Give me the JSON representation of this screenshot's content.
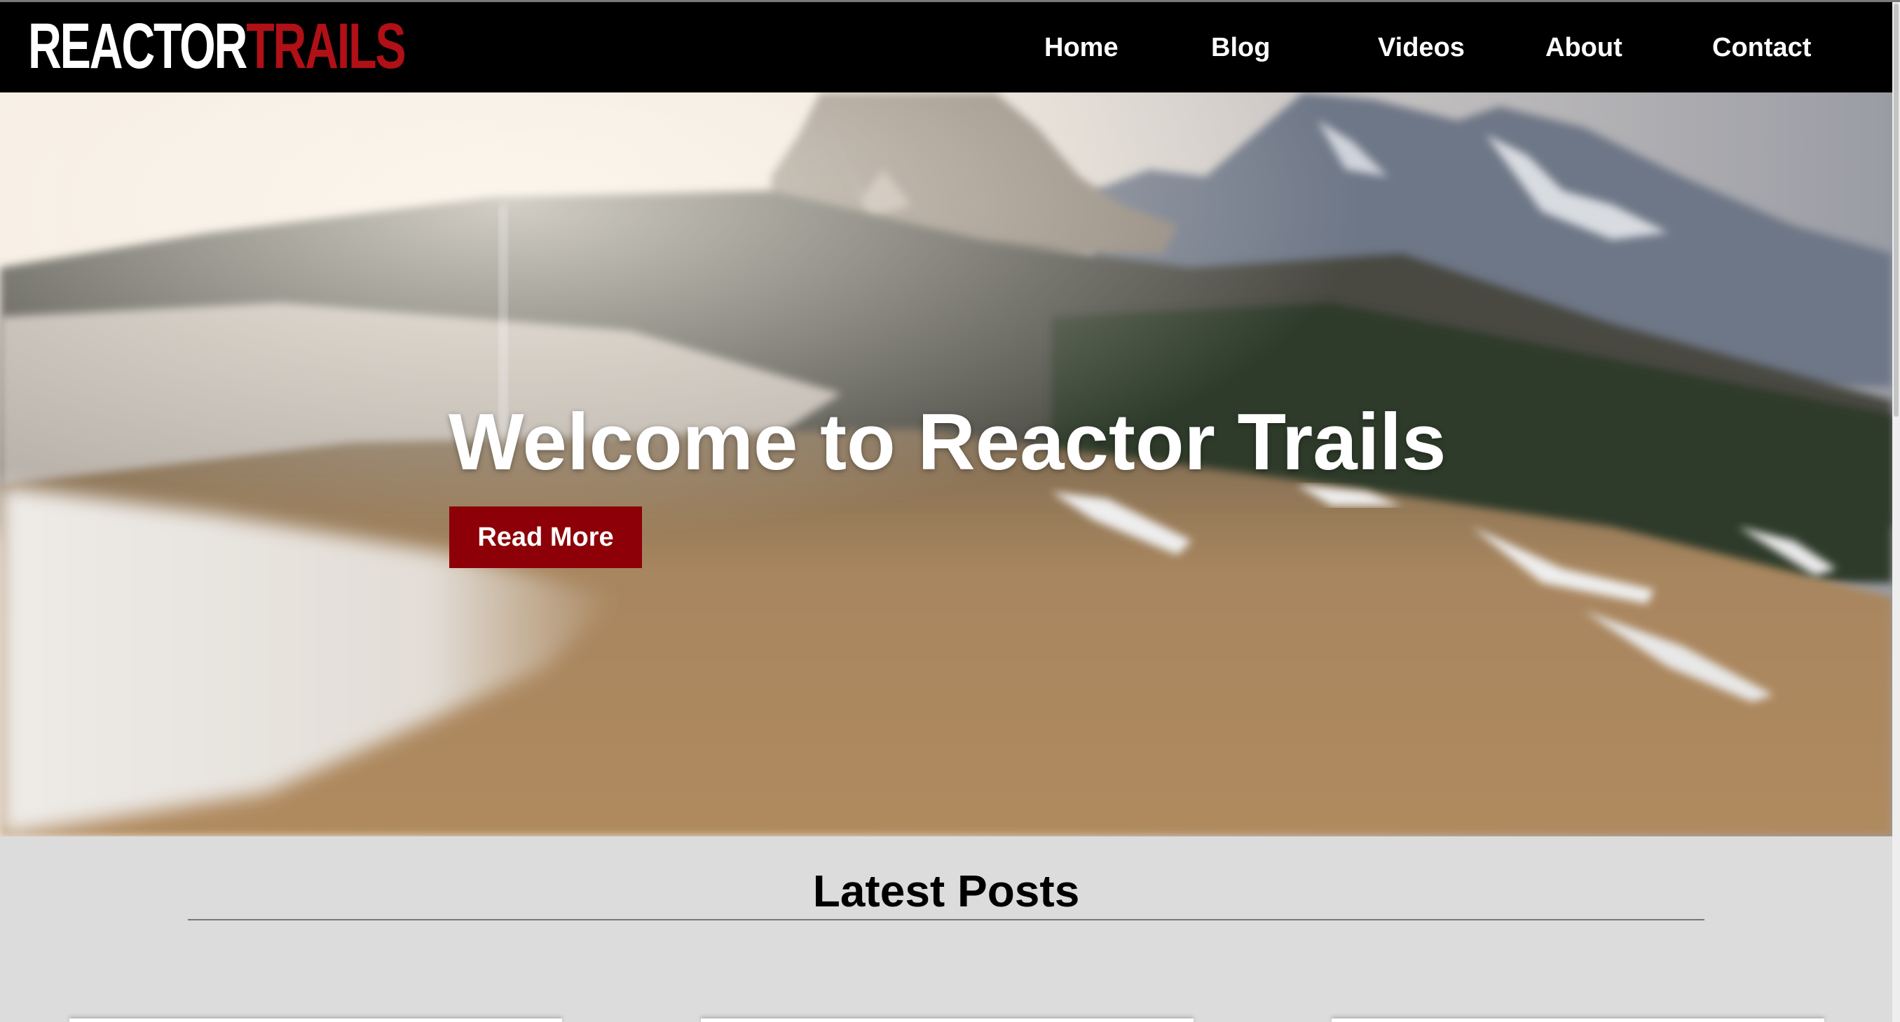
{
  "brand": {
    "logo_primary": "REACTOR",
    "logo_accent": "TRAILS",
    "accent_color": "#b01016"
  },
  "nav": {
    "items": [
      "Home",
      "Blog",
      "Videos",
      "About",
      "Contact"
    ]
  },
  "hero": {
    "title": "Welcome to Reactor Trails",
    "cta_label": "Read More",
    "cta_color": "#8d0008",
    "image": "blurred aerial mountain landscape with snow patches"
  },
  "latest_posts": {
    "title": "Latest Posts",
    "card_count_visible": 3
  },
  "scrollbar": {
    "position_fraction": 0.0
  }
}
